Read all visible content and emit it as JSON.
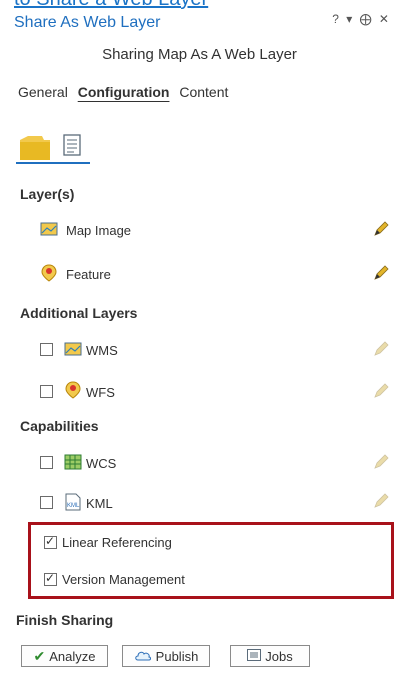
{
  "header": {
    "cutoff_link": "to Share a Web Layer",
    "title": "Share As Web Layer",
    "controls": "? ▾ ⨁ ✕",
    "subtitle": "Sharing Map As A Web Layer"
  },
  "tabs": [
    {
      "label": "General"
    },
    {
      "label": "Configuration",
      "active": true
    },
    {
      "label": "Content"
    }
  ],
  "sections": {
    "layers": "Layer(s)",
    "additional": "Additional Layers",
    "capabilities": "Capabilities",
    "finish": "Finish Sharing"
  },
  "layers": [
    {
      "label": "Map Image",
      "icon": "map-image-icon"
    },
    {
      "label": "Feature",
      "icon": "feature-icon"
    }
  ],
  "additional_layers": [
    {
      "label": "WMS",
      "checked": false,
      "icon": "wms-icon"
    },
    {
      "label": "WFS",
      "checked": false,
      "icon": "wfs-icon"
    }
  ],
  "capabilities": [
    {
      "label": "WCS",
      "checked": false,
      "icon": "wcs-icon"
    },
    {
      "label": "KML",
      "checked": false,
      "icon": "kml-icon"
    },
    {
      "label": "Linear Referencing",
      "checked": true
    },
    {
      "label": "Version Management",
      "checked": true
    }
  ],
  "buttons": {
    "analyze": "Analyze",
    "publish": "Publish",
    "jobs": "Jobs"
  },
  "colors": {
    "accent": "#1f6fbf",
    "highlight_border": "#a8111a",
    "folder_yellow": "#f2c94c"
  }
}
